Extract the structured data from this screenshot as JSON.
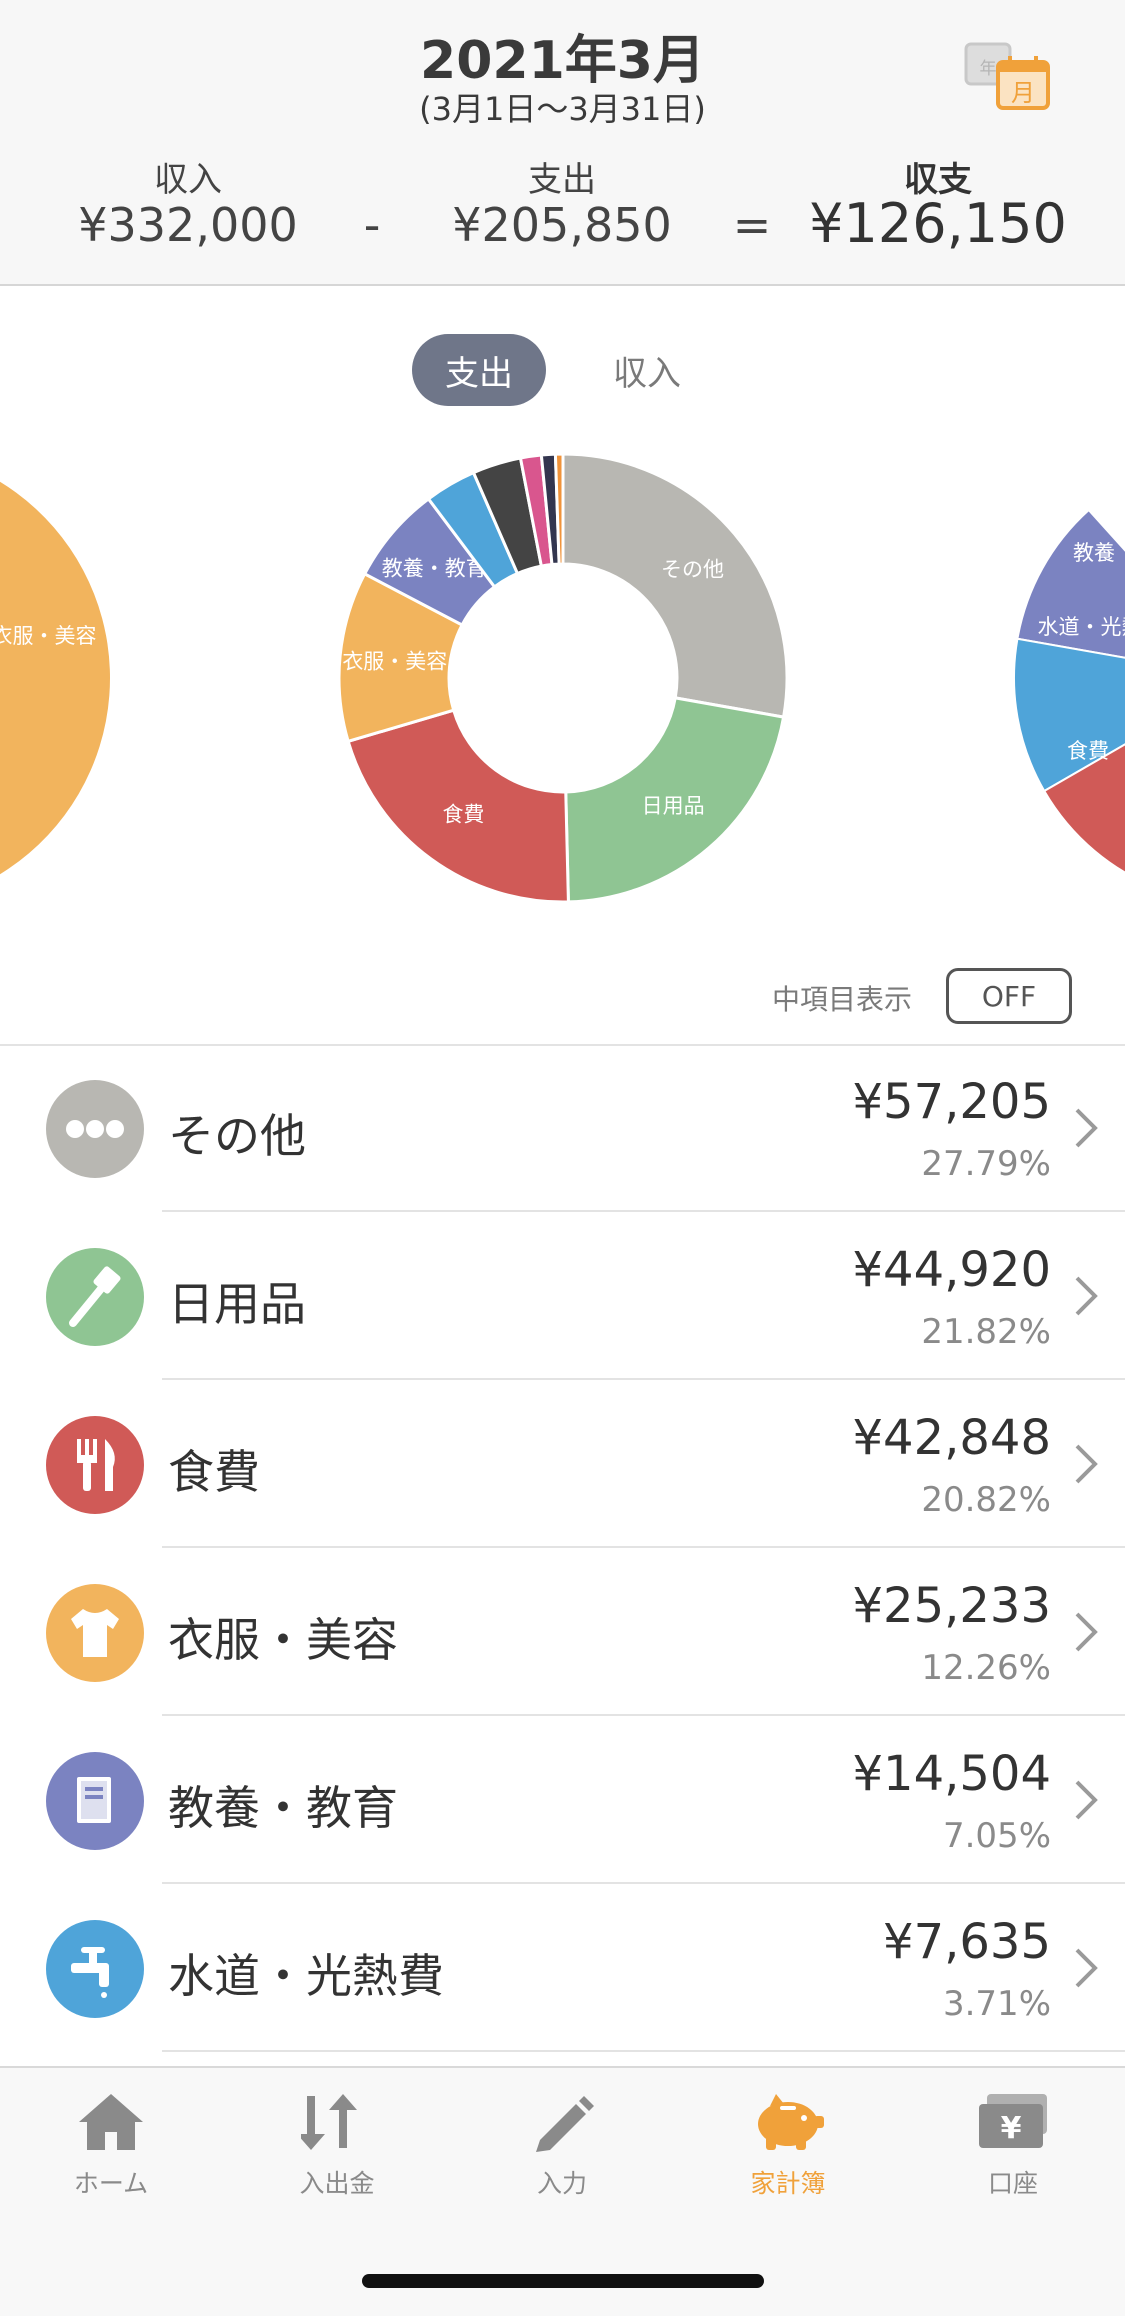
{
  "header": {
    "title": "2021年3月",
    "range": "(3月1日〜3月31日)",
    "calendar_icon": {
      "back_label": "年",
      "front_label": "月"
    },
    "income_label": "収入",
    "income_value": "¥332,000",
    "minus_sign": "-",
    "expense_label": "支出",
    "expense_value": "¥205,850",
    "equals_sign": "=",
    "balance_label": "収支",
    "balance_value": "¥126,150"
  },
  "segment": {
    "expense": "支出",
    "income": "収入",
    "selected": "支出"
  },
  "chart_data": [
    {
      "type": "pie",
      "role": "main-donut",
      "categories": [
        "その他",
        "日用品",
        "食費",
        "衣服・美容",
        "教養・教育",
        "水道・光熱費",
        "other-1",
        "other-2",
        "other-3",
        "other-4"
      ],
      "values": [
        27.79,
        21.82,
        20.82,
        12.26,
        7.05,
        3.71,
        3.5,
        1.5,
        1.0,
        0.54
      ],
      "colors": [
        "#b8b7b2",
        "#8fc593",
        "#d05a57",
        "#f2b45d",
        "#7b83c1",
        "#4fa4d9",
        "#444444",
        "#d9568e",
        "#33364f",
        "#f0933a"
      ],
      "labels": [
        "その他",
        "日用品",
        "食費",
        "衣服・美容",
        "教養・教育"
      ]
    },
    {
      "type": "pie",
      "role": "left-peek",
      "labels": [
        "衣服・美容"
      ]
    },
    {
      "type": "pie",
      "role": "right-peek",
      "labels": [
        "教養",
        "水道・光熱",
        "食費"
      ]
    }
  ],
  "toggle": {
    "label": "中項目表示",
    "value": "OFF"
  },
  "categories": [
    {
      "name": "その他",
      "amount": "¥57,205",
      "percent": "27.79%",
      "color": "#b8b7b2",
      "icon": "dots-icon"
    },
    {
      "name": "日用品",
      "amount": "¥44,920",
      "percent": "21.82%",
      "color": "#8fc593",
      "icon": "toothbrush-icon"
    },
    {
      "name": "食費",
      "amount": "¥42,848",
      "percent": "20.82%",
      "color": "#d05a57",
      "icon": "fork-knife-icon"
    },
    {
      "name": "衣服・美容",
      "amount": "¥25,233",
      "percent": "12.26%",
      "color": "#f2b45d",
      "icon": "tshirt-icon"
    },
    {
      "name": "教養・教育",
      "amount": "¥14,504",
      "percent": "7.05%",
      "color": "#7b83c1",
      "icon": "book-icon"
    },
    {
      "name": "水道・光熱費",
      "amount": "¥7,635",
      "percent": "3.71%",
      "color": "#4fa4d9",
      "icon": "faucet-icon"
    }
  ],
  "tabbar": {
    "items": [
      {
        "label": "ホーム",
        "icon": "home-icon"
      },
      {
        "label": "入出金",
        "icon": "transfer-arrows-icon"
      },
      {
        "label": "入力",
        "icon": "pencil-icon"
      },
      {
        "label": "家計簿",
        "icon": "piggy-bank-icon"
      },
      {
        "label": "口座",
        "icon": "wallet-icon"
      }
    ],
    "active": "家計簿",
    "active_color": "#f0a13a"
  }
}
